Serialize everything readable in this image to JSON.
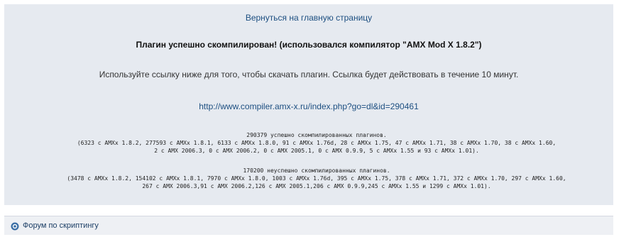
{
  "main": {
    "back_link": "Вернуться на главную страницу",
    "success_message": "Плагин успешно скомпилирован! (использовался компилятор \"AMX Mod X 1.8.2\")",
    "instruction": "Используйте ссылку ниже для того, чтобы скачать плагин. Ссылка будет действовать в течение 10 минут.",
    "download_url": "http://www.compiler.amx-x.ru/index.php?go=dl&id=290461"
  },
  "stats": {
    "success_lines": [
      "290379 успешно скомпилированных плагинов.",
      "(6323 с AMXx 1.8.2, 277593 с AMXx 1.8.1, 6133 с AMXx 1.8.0, 91 с AMXx 1.76d, 28 с AMXx 1.75, 47 с AMXx 1.71, 38 с AMXx 1.70, 38 с AMXx 1.60,",
      "2 с AMX 2006.3, 0 с AMX 2006.2, 0 с AMX 2005.1, 0 с AMX 0.9.9, 5 с AMXx 1.55 и 93 с AMXx 1.01)."
    ],
    "fail_lines": [
      "170200 неуспешно скомпилированных плагинов.",
      "(3478 с AMXx 1.8.2, 154102 с AMXx 1.8.1, 7970 с AMXx 1.8.0, 1003 с AMXx 1.76d, 395 с AMXx 1.75, 378 с AMXx 1.71, 372 с AMXx 1.70, 297 с AMXx 1.60,",
      "267 с AMX 2006.3,91 с AMX 2006.2,126 с AMX 2005.1,206 с AMX 0.9.9,245 с AMXx 1.55 и 1299 с AMXx 1.01)."
    ]
  },
  "footer": {
    "forum_link": "Форум по скриптингу",
    "icon": "forum-bubble-icon"
  },
  "colors": {
    "panel_bg": "#e6eaf0",
    "link": "#1d4f81"
  }
}
